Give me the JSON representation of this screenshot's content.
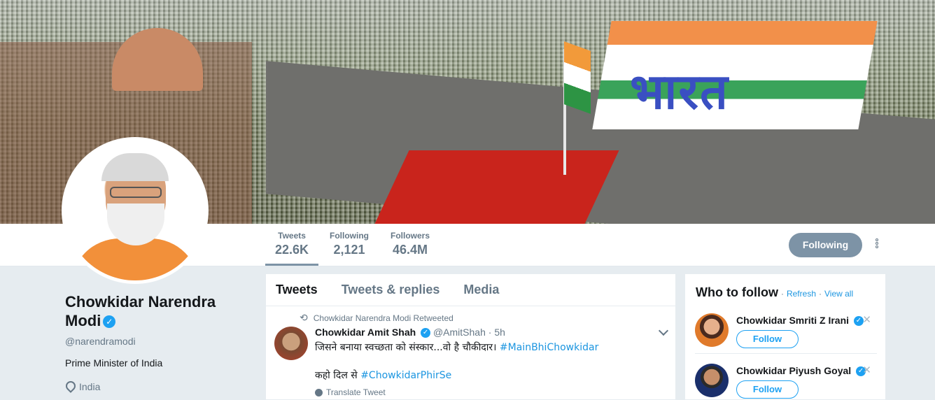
{
  "stats": [
    {
      "label": "Tweets",
      "value": "22.6K"
    },
    {
      "label": "Following",
      "value": "2,121"
    },
    {
      "label": "Followers",
      "value": "46.4M"
    }
  ],
  "follow_button": "Following",
  "profile": {
    "name": "Chowkidar Narendra Modi",
    "handle": "@narendramodi",
    "bio": "Prime Minister of India",
    "location": "India"
  },
  "banner_text": "भारत",
  "tabs": [
    "Tweets",
    "Tweets & replies",
    "Media"
  ],
  "tweet": {
    "retweeted_by": "Chowkidar Narendra Modi Retweeted",
    "author": "Chowkidar Amit Shah",
    "handle": "@AmitShah",
    "time": "5h",
    "text_main": "जिसने बनाया स्वच्छता को संस्कार...वो है चौकीदार।",
    "hashtag1": "#MainBhiChowkidar",
    "text_line2": "कहो दिल से",
    "hashtag2": "#ChowkidarPhirSe",
    "translate": "Translate Tweet"
  },
  "who_to_follow": {
    "title": "Who to follow",
    "refresh": "Refresh",
    "view_all": "View all",
    "suggestions": [
      {
        "name": "Chowkidar Smriti Z Irani",
        "follow": "Follow"
      },
      {
        "name": "Chowkidar Piyush Goyal",
        "follow": "Follow"
      }
    ]
  },
  "colors": {
    "accent": "#1da1f2",
    "following_button": "#7d93a6",
    "link": "#1b95e0"
  }
}
